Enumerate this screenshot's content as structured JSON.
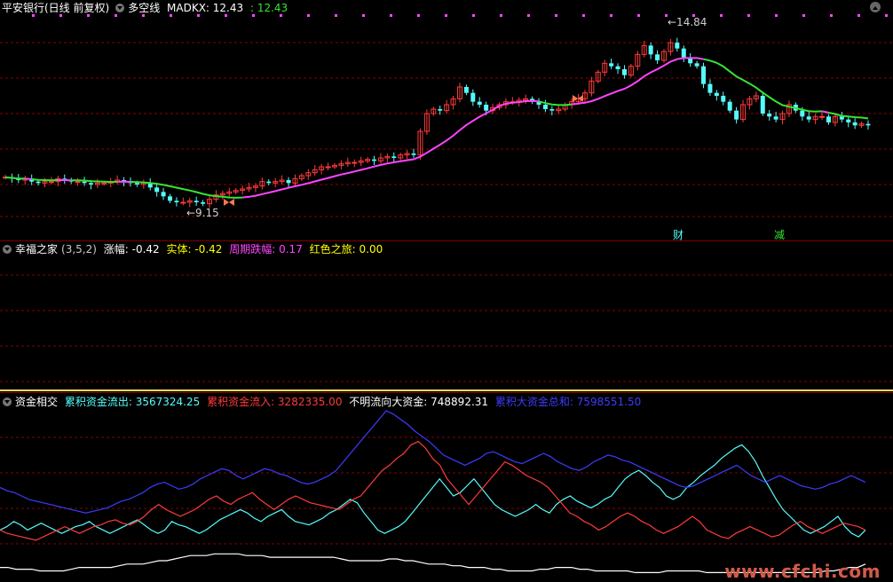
{
  "main": {
    "stock_title": "平安银行(日线 前复权)",
    "indicator_name": "多空线",
    "madkx_label": "MADKX: 12.43",
    "madkx_value2": ": 12.43",
    "high_label": "←14.84",
    "low_label": "←9.15",
    "marker_cai": "财",
    "marker_jian": "减",
    "colors": {
      "up": "#ff3b3b",
      "down": "#54fcfc",
      "ma_bull": "#ff44ff",
      "ma_bear": "#34e534",
      "grid": "#8a0000"
    }
  },
  "panel2": {
    "name": "幸福之家",
    "params": "(3,5,2)",
    "zhangfu": "涨幅: -0.42",
    "shiti": "实体: -0.42",
    "zhouqi": "周期跌幅: 0.17",
    "hongse": "红色之旅: 0.00"
  },
  "panel3": {
    "name": "资金相交",
    "outflow": "累积资金流出: 3567324.25",
    "inflow": "累积资金流入: 3282335.00",
    "unknown": "不明流向大资金: 748892.31",
    "total": "累积大资金总和: 7598551.50"
  },
  "watermark": "www.cfchi.com",
  "chart_data": [
    {
      "type": "candlestick",
      "title": "平安银行(日线 前复权)",
      "annotations": [
        "←14.84",
        "←9.15",
        "财",
        "减"
      ],
      "ylim": [
        8.3,
        15.5
      ],
      "ohlc_closes": [
        10.05,
        10.0,
        9.95,
        10.0,
        9.9,
        9.85,
        9.9,
        9.9,
        10.0,
        9.95,
        9.9,
        9.9,
        9.85,
        9.8,
        9.85,
        9.85,
        9.9,
        9.95,
        9.9,
        9.85,
        9.8,
        9.85,
        9.7,
        9.55,
        9.4,
        9.25,
        9.2,
        9.2,
        9.25,
        9.2,
        9.15,
        9.3,
        9.45,
        9.5,
        9.55,
        9.6,
        9.65,
        9.7,
        9.75,
        9.9,
        9.85,
        9.9,
        9.95,
        9.85,
        10.0,
        10.1,
        10.2,
        10.3,
        10.4,
        10.4,
        10.45,
        10.5,
        10.55,
        10.55,
        10.6,
        10.65,
        10.6,
        10.7,
        10.75,
        10.7,
        10.8,
        10.85,
        10.8,
        11.6,
        12.2,
        12.35,
        12.3,
        12.5,
        12.7,
        13.1,
        12.9,
        12.6,
        12.5,
        12.3,
        12.4,
        12.5,
        12.6,
        12.6,
        12.65,
        12.7,
        12.6,
        12.5,
        12.35,
        12.3,
        12.35,
        12.5,
        12.6,
        12.7,
        12.9,
        13.3,
        13.6,
        13.9,
        13.8,
        13.7,
        13.5,
        13.8,
        14.2,
        14.5,
        14.2,
        14.0,
        14.3,
        14.6,
        14.4,
        14.1,
        13.9,
        13.8,
        13.2,
        12.9,
        12.8,
        12.6,
        12.3,
        12.0,
        12.5,
        12.7,
        12.8,
        12.2,
        12.1,
        12.0,
        12.2,
        12.5,
        12.3,
        12.1,
        12.0,
        12.1,
        12.1,
        11.9,
        12.1,
        12.0,
        11.9,
        11.8,
        11.85,
        11.8
      ]
    },
    {
      "type": "line",
      "title": "资金相交",
      "series": [
        {
          "name": "累积资金流出",
          "values": [
            0.3,
            0.32,
            0.35,
            0.33,
            0.3,
            0.32,
            0.34,
            0.32,
            0.3,
            0.28,
            0.3,
            0.32,
            0.33,
            0.35,
            0.32,
            0.3,
            0.28,
            0.3,
            0.32,
            0.34,
            0.36,
            0.33,
            0.3,
            0.28,
            0.3,
            0.35,
            0.33,
            0.32,
            0.3,
            0.28,
            0.3,
            0.33,
            0.36,
            0.38,
            0.4,
            0.42,
            0.4,
            0.37,
            0.35,
            0.38,
            0.4,
            0.42,
            0.38,
            0.35,
            0.34,
            0.33,
            0.35,
            0.37,
            0.4,
            0.42,
            0.45,
            0.48,
            0.46,
            0.4,
            0.35,
            0.3,
            0.28,
            0.3,
            0.32,
            0.35,
            0.4,
            0.45,
            0.5,
            0.55,
            0.6,
            0.55,
            0.5,
            0.52,
            0.56,
            0.6,
            0.55,
            0.5,
            0.45,
            0.42,
            0.4,
            0.38,
            0.4,
            0.42,
            0.45,
            0.42,
            0.4,
            0.45,
            0.48,
            0.5,
            0.47,
            0.45,
            0.43,
            0.45,
            0.48,
            0.5,
            0.55,
            0.6,
            0.63,
            0.65,
            0.62,
            0.58,
            0.55,
            0.5,
            0.48,
            0.5,
            0.55,
            0.58,
            0.62,
            0.65,
            0.68,
            0.72,
            0.75,
            0.78,
            0.8,
            0.76,
            0.7,
            0.62,
            0.55,
            0.48,
            0.42,
            0.38,
            0.34,
            0.3,
            0.28,
            0.3,
            0.32,
            0.35,
            0.38,
            0.32,
            0.28,
            0.26,
            0.3
          ]
        },
        {
          "name": "累积资金流入",
          "values": [
            0.3,
            0.28,
            0.27,
            0.26,
            0.25,
            0.24,
            0.26,
            0.28,
            0.3,
            0.32,
            0.3,
            0.28,
            0.3,
            0.32,
            0.33,
            0.35,
            0.36,
            0.34,
            0.33,
            0.35,
            0.38,
            0.42,
            0.45,
            0.42,
            0.4,
            0.38,
            0.4,
            0.42,
            0.45,
            0.48,
            0.5,
            0.47,
            0.45,
            0.48,
            0.5,
            0.52,
            0.48,
            0.45,
            0.42,
            0.45,
            0.48,
            0.5,
            0.48,
            0.46,
            0.45,
            0.44,
            0.43,
            0.42,
            0.45,
            0.48,
            0.5,
            0.55,
            0.6,
            0.65,
            0.68,
            0.72,
            0.75,
            0.8,
            0.82,
            0.78,
            0.72,
            0.68,
            0.6,
            0.55,
            0.5,
            0.45,
            0.5,
            0.55,
            0.6,
            0.65,
            0.7,
            0.68,
            0.65,
            0.62,
            0.6,
            0.58,
            0.55,
            0.5,
            0.45,
            0.4,
            0.38,
            0.35,
            0.33,
            0.3,
            0.32,
            0.35,
            0.38,
            0.4,
            0.38,
            0.35,
            0.33,
            0.3,
            0.28,
            0.3,
            0.32,
            0.35,
            0.38,
            0.35,
            0.3,
            0.28,
            0.26,
            0.25,
            0.28,
            0.3,
            0.32,
            0.3,
            0.28,
            0.26,
            0.27,
            0.3,
            0.33,
            0.35,
            0.32,
            0.3,
            0.28,
            0.3,
            0.32,
            0.34,
            0.33,
            0.32,
            0.3
          ]
        },
        {
          "name": "累积大资金总和",
          "values": [
            0.55,
            0.53,
            0.52,
            0.5,
            0.48,
            0.47,
            0.46,
            0.45,
            0.44,
            0.43,
            0.42,
            0.41,
            0.4,
            0.41,
            0.42,
            0.43,
            0.45,
            0.47,
            0.48,
            0.5,
            0.52,
            0.55,
            0.57,
            0.58,
            0.56,
            0.54,
            0.55,
            0.57,
            0.6,
            0.62,
            0.64,
            0.66,
            0.65,
            0.62,
            0.6,
            0.62,
            0.64,
            0.66,
            0.65,
            0.63,
            0.62,
            0.6,
            0.58,
            0.57,
            0.58,
            0.6,
            0.62,
            0.65,
            0.7,
            0.75,
            0.8,
            0.85,
            0.9,
            0.95,
            1.0,
            0.98,
            0.95,
            0.92,
            0.88,
            0.85,
            0.82,
            0.78,
            0.74,
            0.72,
            0.7,
            0.68,
            0.7,
            0.72,
            0.75,
            0.76,
            0.74,
            0.72,
            0.7,
            0.69,
            0.71,
            0.73,
            0.75,
            0.73,
            0.7,
            0.68,
            0.66,
            0.65,
            0.67,
            0.7,
            0.72,
            0.74,
            0.73,
            0.71,
            0.7,
            0.68,
            0.66,
            0.64,
            0.62,
            0.6,
            0.58,
            0.56,
            0.55,
            0.56,
            0.58,
            0.6,
            0.62,
            0.64,
            0.66,
            0.68,
            0.65,
            0.62,
            0.6,
            0.58,
            0.6,
            0.62,
            0.6,
            0.58,
            0.56,
            0.55,
            0.54,
            0.55,
            0.57,
            0.58,
            0.6,
            0.62,
            0.6,
            0.58
          ]
        },
        {
          "name": "不明流向大资金",
          "values": [
            0.08,
            0.08,
            0.07,
            0.07,
            0.07,
            0.06,
            0.06,
            0.06,
            0.06,
            0.07,
            0.08,
            0.08,
            0.08,
            0.08,
            0.08,
            0.09,
            0.1,
            0.1,
            0.1,
            0.11,
            0.12,
            0.12,
            0.13,
            0.14,
            0.15,
            0.15,
            0.15,
            0.16,
            0.16,
            0.16,
            0.16,
            0.15,
            0.15,
            0.15,
            0.14,
            0.14,
            0.14,
            0.14,
            0.14,
            0.14,
            0.14,
            0.14,
            0.14,
            0.13,
            0.12,
            0.12,
            0.12,
            0.12,
            0.12,
            0.13,
            0.13,
            0.12,
            0.12,
            0.11,
            0.1,
            0.1,
            0.1,
            0.09,
            0.09,
            0.08,
            0.08,
            0.08,
            0.07,
            0.07,
            0.06,
            0.06,
            0.06,
            0.06,
            0.07,
            0.07,
            0.08,
            0.08,
            0.08,
            0.07,
            0.07,
            0.06,
            0.06,
            0.06,
            0.06,
            0.06,
            0.05,
            0.05,
            0.05,
            0.05,
            0.06,
            0.06,
            0.06,
            0.06,
            0.06,
            0.05,
            0.05,
            0.05,
            0.05,
            0.05,
            0.05,
            0.05,
            0.05,
            0.05,
            0.05,
            0.05,
            0.05,
            0.05,
            0.05,
            0.05,
            0.06,
            0.06,
            0.07,
            0.08,
            0.08,
            0.1
          ]
        }
      ]
    }
  ]
}
